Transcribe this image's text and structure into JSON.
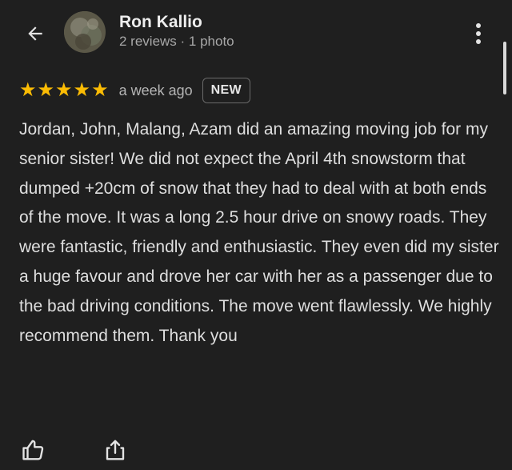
{
  "reviewer": {
    "name": "Ron Kallio",
    "meta": "2 reviews · 1 photo"
  },
  "review": {
    "rating": 5,
    "stars": [
      "★",
      "★",
      "★",
      "★",
      "★"
    ],
    "time_ago": "a week ago",
    "badge": "NEW",
    "text": "Jordan, John, Malang, Azam did an amazing moving job for my senior sister! We did not expect the April 4th snowstorm that dumped +20cm of snow that they had to deal with at both ends of the move. It was a long 2.5 hour drive on snowy roads. They were fantastic, friendly and enthusiastic. They even did my sister a huge favour and drove her car with her as a passenger due to the bad driving conditions. The move went flawlessly. We highly recommend them. Thank you"
  },
  "icons": {
    "back": "arrow-left-icon",
    "more": "more-vert-icon",
    "like": "thumb-up-icon",
    "share": "share-icon"
  },
  "colors": {
    "background": "#1f1f1f",
    "star": "#fbbc04",
    "text": "#dedede",
    "secondary_text": "#a8a8a8"
  }
}
